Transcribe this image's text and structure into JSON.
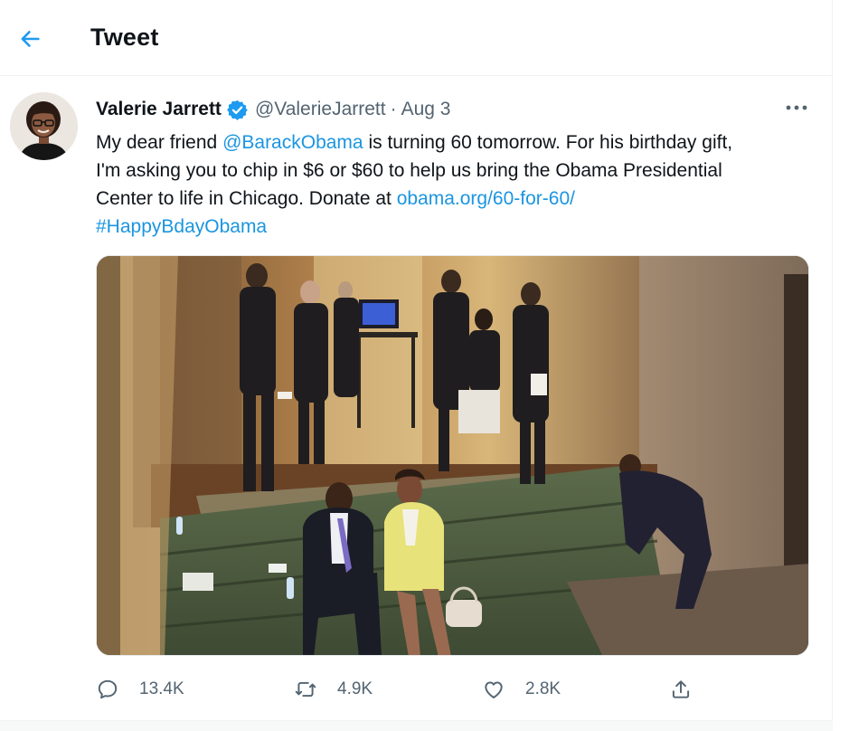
{
  "header": {
    "title": "Tweet"
  },
  "tweet": {
    "author": {
      "display_name": "Valerie Jarrett",
      "handle": "@ValerieJarrett",
      "verified": true
    },
    "date": "Aug 3",
    "separator": "·",
    "text": {
      "line1_before": "My dear friend ",
      "mention": "@BarackObama",
      "line1_after": " is turning 60 tomorrow. For his birthday gift,",
      "line2": "I'm asking you to chip in $6 or $60 to help us bring the Obama Presidential",
      "line3_before": "Center to life in Chicago. Donate at ",
      "url": "obama.org/60-for-60/",
      "hashtag": "#HappyBdayObama"
    },
    "stats": {
      "replies": "13.4K",
      "retweets": "4.9K",
      "likes": "2.8K"
    }
  },
  "icons": {
    "back": "arrow-left-icon",
    "verified": "verified-badge-icon",
    "more": "more-horizontal-icon",
    "reply": "reply-bubble-icon",
    "retweet": "retweet-icon",
    "like": "heart-icon",
    "share": "share-upload-icon"
  },
  "colors": {
    "accent": "#1d9bf0",
    "link": "#1b95e0",
    "text": "#0f1419",
    "secondary": "#536471"
  }
}
